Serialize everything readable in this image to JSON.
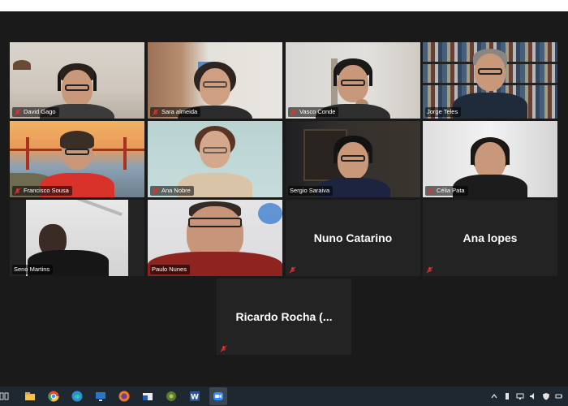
{
  "meeting": {
    "participants": [
      {
        "name": "David Gago"
      },
      {
        "name": "Sara almeida"
      },
      {
        "name": "Vasco Conde"
      },
      {
        "name": "Jorge Teles"
      },
      {
        "name": "Francisco Sousa"
      },
      {
        "name": "Ana Nobre"
      },
      {
        "name": "Sergio Saraiva"
      },
      {
        "name": "Célia Pata"
      },
      {
        "name": "Seno Martins"
      },
      {
        "name": "Paulo Nunes"
      },
      {
        "name": "Nuno Catarino"
      },
      {
        "name": "Ana lopes"
      },
      {
        "name": "Ricardo  Rocha  (..."
      }
    ],
    "active_speaker": "Sergio Saraiva",
    "colors": {
      "background": "#1a1a1a",
      "tile": "#232323",
      "active_border": "#b8d24a",
      "muted_icon": "#e0312f"
    }
  },
  "taskbar": {
    "apps": [
      "file-explorer-icon",
      "chrome-icon",
      "edge-icon",
      "remote-desktop-icon",
      "firefox-icon",
      "outlook-icon",
      "game-icon",
      "word-icon",
      "zoom-icon"
    ],
    "active_app": "zoom-icon"
  }
}
